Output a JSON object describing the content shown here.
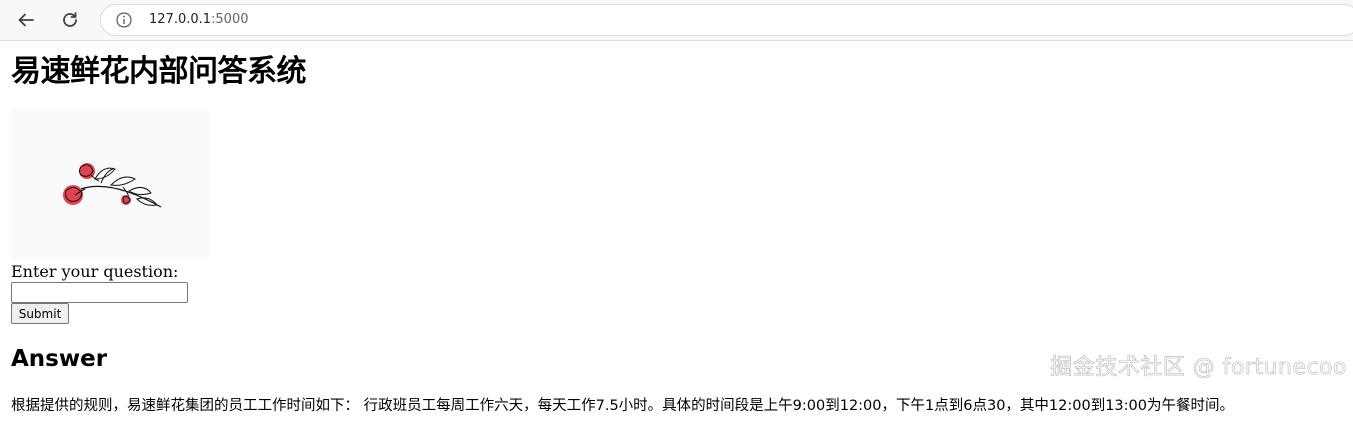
{
  "browser": {
    "url_host": "127.0.0.1",
    "url_port": ":5000",
    "icons": {
      "back": "arrow-left-icon",
      "reload": "reload-icon",
      "site_info": "info-icon"
    }
  },
  "page": {
    "title": "易速鲜花内部问答系统",
    "image_alt": "flower-illustration",
    "question_label": "Enter your question:",
    "question_value": "",
    "submit_label": "Submit",
    "answer_heading": "Answer",
    "answer_text": "根据提供的规则，易速鲜花集团的员工工作时间如下： 行政班员工每周工作六天，每天工作7.5小时。具体的时间段是上午9:00到12:00，下午1点到6点30，其中12:00到13:00为午餐时间。"
  },
  "watermark": "掘金技术社区 @ fortunecoo",
  "colors": {
    "flower_accent": "#e0454f",
    "chrome_bg": "#f7f8fa"
  }
}
